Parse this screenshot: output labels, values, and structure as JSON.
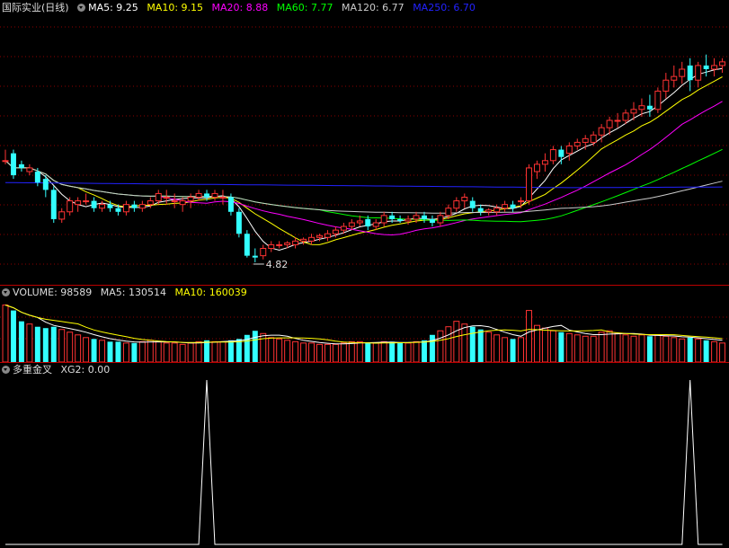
{
  "price_panel": {
    "title": "国际实业(日线)",
    "ma": [
      {
        "label": "MA5: 9.25",
        "color": "#ffffff"
      },
      {
        "label": "MA10: 9.15",
        "color": "#ffff00"
      },
      {
        "label": "MA20: 8.88",
        "color": "#ff00ff"
      },
      {
        "label": "MA60: 7.77",
        "color": "#00ff00"
      },
      {
        "label": "MA120: 6.77",
        "color": "#cccccc"
      },
      {
        "label": "MA250: 6.70",
        "color": "#2222ff"
      }
    ],
    "low_marker": "4.82"
  },
  "volume_panel": {
    "labels": [
      {
        "label": "VOLUME: 98589",
        "color": "#dddddd"
      },
      {
        "label": "MA5: 130514",
        "color": "#dddddd"
      },
      {
        "label": "MA10: 160039",
        "color": "#ffff00"
      }
    ]
  },
  "indicator_panel": {
    "labels": [
      {
        "label": "多重金叉",
        "color": "#dddddd"
      },
      {
        "label": "XG2: 0.00",
        "color": "#dddddd"
      }
    ]
  },
  "colors": {
    "up": "#ff3333",
    "down": "#33ffff",
    "grid": "#8b0000",
    "ma_white": "#ffffff",
    "ma_yellow": "#ffff00",
    "ma_magenta": "#ff00ff",
    "ma_green": "#00ff00",
    "ma_gray": "#cccccc",
    "ma_blue": "#2222ff"
  },
  "chart_data": [
    {
      "type": "candlestick",
      "title": "国际实业(日线)",
      "yrange": [
        4.5,
        11.5
      ],
      "grid": true,
      "low_value": 4.82,
      "candles": [
        [
          7.6,
          7.9,
          7.6,
          7.5
        ],
        [
          7.8,
          7.9,
          7.2,
          7.1
        ],
        [
          7.5,
          7.6,
          7.4,
          7.3
        ],
        [
          7.3,
          7.5,
          7.4,
          7.2
        ],
        [
          7.3,
          7.4,
          7.0,
          6.9
        ],
        [
          7.1,
          7.2,
          6.8,
          6.6
        ],
        [
          6.8,
          6.9,
          6.0,
          5.9
        ],
        [
          6.0,
          6.3,
          6.2,
          5.9
        ],
        [
          6.2,
          6.6,
          6.5,
          6.1
        ],
        [
          6.4,
          6.6,
          6.5,
          6.2
        ],
        [
          6.5,
          6.7,
          6.5,
          6.4
        ],
        [
          6.5,
          6.6,
          6.3,
          6.2
        ],
        [
          6.3,
          6.5,
          6.4,
          6.2
        ],
        [
          6.4,
          6.5,
          6.3,
          6.2
        ],
        [
          6.3,
          6.4,
          6.2,
          6.1
        ],
        [
          6.2,
          6.5,
          6.4,
          6.1
        ],
        [
          6.4,
          6.5,
          6.3,
          6.2
        ],
        [
          6.3,
          6.5,
          6.4,
          6.2
        ],
        [
          6.4,
          6.6,
          6.5,
          6.3
        ],
        [
          6.5,
          6.8,
          6.7,
          6.4
        ],
        [
          6.6,
          6.8,
          6.6,
          6.4
        ],
        [
          6.5,
          6.7,
          6.5,
          6.3
        ],
        [
          6.4,
          6.6,
          6.5,
          6.2
        ],
        [
          6.5,
          6.7,
          6.6,
          6.3
        ],
        [
          6.6,
          6.8,
          6.7,
          6.5
        ],
        [
          6.7,
          6.8,
          6.6,
          6.5
        ],
        [
          6.6,
          6.8,
          6.7,
          6.5
        ],
        [
          6.6,
          6.8,
          6.6,
          6.4
        ],
        [
          6.6,
          6.7,
          6.2,
          6.1
        ],
        [
          6.2,
          6.3,
          5.6,
          5.5
        ],
        [
          5.6,
          5.7,
          5.0,
          4.95
        ],
        [
          5.0,
          5.2,
          4.95,
          4.82
        ],
        [
          5.0,
          5.3,
          5.2,
          4.9
        ],
        [
          5.2,
          5.4,
          5.3,
          5.1
        ],
        [
          5.3,
          5.4,
          5.3,
          5.2
        ],
        [
          5.3,
          5.4,
          5.35,
          5.2
        ],
        [
          5.3,
          5.5,
          5.4,
          5.2
        ],
        [
          5.4,
          5.5,
          5.45,
          5.3
        ],
        [
          5.4,
          5.6,
          5.5,
          5.3
        ],
        [
          5.5,
          5.6,
          5.55,
          5.4
        ],
        [
          5.5,
          5.7,
          5.6,
          5.4
        ],
        [
          5.6,
          5.8,
          5.7,
          5.5
        ],
        [
          5.7,
          5.9,
          5.8,
          5.6
        ],
        [
          5.8,
          6.0,
          5.9,
          5.7
        ],
        [
          5.9,
          6.1,
          5.95,
          5.8
        ],
        [
          6.0,
          6.1,
          5.8,
          5.7
        ],
        [
          5.8,
          6.0,
          5.9,
          5.7
        ],
        [
          5.9,
          6.2,
          6.1,
          5.8
        ],
        [
          6.1,
          6.2,
          6.0,
          5.9
        ],
        [
          6.0,
          6.1,
          5.95,
          5.9
        ],
        [
          5.95,
          6.1,
          6.0,
          5.85
        ],
        [
          6.0,
          6.2,
          6.1,
          5.9
        ],
        [
          6.1,
          6.2,
          6.0,
          5.9
        ],
        [
          6.0,
          6.1,
          5.9,
          5.8
        ],
        [
          5.9,
          6.2,
          6.1,
          5.8
        ],
        [
          6.1,
          6.4,
          6.3,
          6.0
        ],
        [
          6.3,
          6.6,
          6.5,
          6.2
        ],
        [
          6.5,
          6.7,
          6.6,
          6.3
        ],
        [
          6.5,
          6.6,
          6.3,
          6.2
        ],
        [
          6.3,
          6.4,
          6.2,
          6.1
        ],
        [
          6.2,
          6.3,
          6.25,
          6.1
        ],
        [
          6.2,
          6.4,
          6.3,
          6.1
        ],
        [
          6.3,
          6.5,
          6.4,
          6.2
        ],
        [
          6.4,
          6.5,
          6.3,
          6.2
        ],
        [
          6.5,
          6.6,
          6.5,
          6.3
        ],
        [
          6.5,
          7.5,
          7.4,
          6.4
        ],
        [
          7.3,
          7.6,
          7.5,
          7.1
        ],
        [
          7.5,
          7.8,
          7.6,
          7.3
        ],
        [
          7.6,
          8.0,
          7.9,
          7.5
        ],
        [
          7.9,
          8.0,
          7.7,
          7.5
        ],
        [
          7.8,
          8.1,
          8.0,
          7.6
        ],
        [
          8.0,
          8.2,
          8.1,
          7.9
        ],
        [
          8.1,
          8.3,
          8.2,
          7.9
        ],
        [
          8.1,
          8.4,
          8.3,
          8.0
        ],
        [
          8.3,
          8.6,
          8.5,
          8.1
        ],
        [
          8.5,
          8.8,
          8.7,
          8.3
        ],
        [
          8.7,
          8.9,
          8.7,
          8.5
        ],
        [
          8.7,
          9.0,
          8.9,
          8.6
        ],
        [
          8.9,
          9.2,
          9.0,
          8.7
        ],
        [
          9.0,
          9.3,
          9.1,
          8.8
        ],
        [
          9.1,
          9.4,
          9.0,
          8.8
        ],
        [
          9.0,
          9.6,
          9.5,
          8.9
        ],
        [
          9.5,
          10.0,
          9.8,
          9.3
        ],
        [
          9.8,
          10.2,
          9.9,
          9.6
        ],
        [
          9.9,
          10.3,
          10.1,
          9.7
        ],
        [
          10.2,
          10.4,
          9.8,
          9.5
        ],
        [
          9.8,
          10.3,
          10.2,
          9.6
        ],
        [
          10.2,
          10.5,
          10.1,
          9.9
        ],
        [
          10.1,
          10.4,
          10.2,
          9.9
        ],
        [
          10.2,
          10.4,
          10.3,
          10.0
        ]
      ]
    },
    {
      "type": "bar",
      "title": "VOLUME",
      "values": [
        420000,
        380000,
        300000,
        280000,
        260000,
        250000,
        260000,
        240000,
        220000,
        200000,
        180000,
        170000,
        160000,
        150000,
        150000,
        140000,
        140000,
        150000,
        160000,
        150000,
        140000,
        140000,
        130000,
        140000,
        150000,
        160000,
        150000,
        150000,
        160000,
        170000,
        200000,
        230000,
        210000,
        180000,
        170000,
        160000,
        150000,
        140000,
        140000,
        130000,
        130000,
        130000,
        140000,
        150000,
        150000,
        140000,
        140000,
        150000,
        150000,
        140000,
        140000,
        150000,
        160000,
        200000,
        230000,
        260000,
        300000,
        280000,
        260000,
        240000,
        220000,
        200000,
        180000,
        170000,
        180000,
        380000,
        270000,
        250000,
        230000,
        220000,
        210000,
        200000,
        190000,
        190000,
        220000,
        230000,
        210000,
        200000,
        190000,
        200000,
        190000,
        200000,
        190000,
        180000,
        170000,
        180000,
        170000,
        160000,
        150000,
        140000
      ],
      "ylim": [
        0,
        450000
      ]
    },
    {
      "type": "line",
      "title": "多重金叉",
      "series": [
        {
          "name": "XG2",
          "spike_index": [
            25,
            85
          ],
          "value": 1
        }
      ]
    }
  ]
}
